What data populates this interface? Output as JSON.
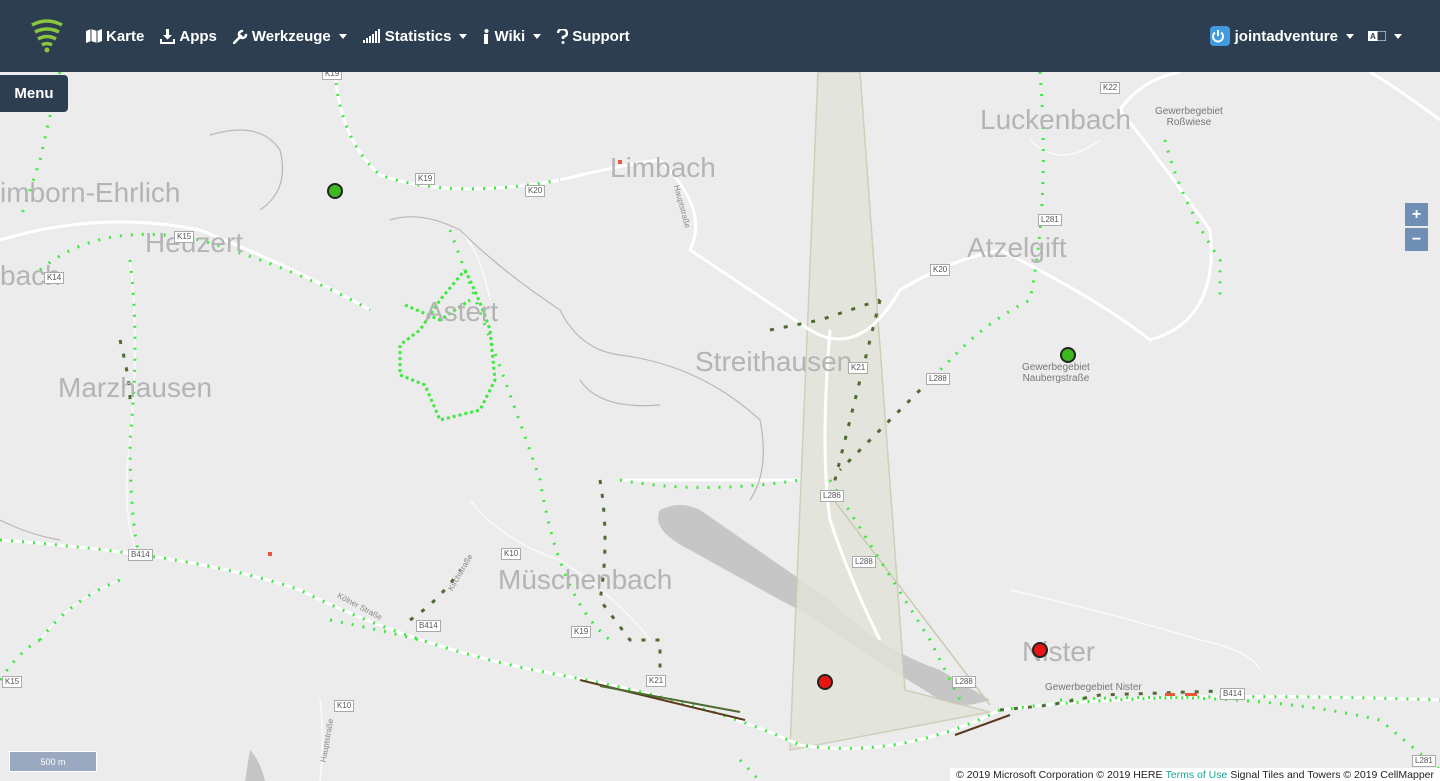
{
  "nav": {
    "items": [
      {
        "label": "Karte",
        "icon": "map-icon"
      },
      {
        "label": "Apps",
        "icon": "download-icon"
      },
      {
        "label": "Werkzeuge",
        "icon": "wrench-icon"
      },
      {
        "label": "Statistics",
        "icon": "signal-bars-icon"
      },
      {
        "label": "Wiki",
        "icon": "info-icon"
      },
      {
        "label": "Support",
        "icon": "question-icon"
      }
    ],
    "user": "jointadventure"
  },
  "menu_label": "Menu",
  "zoom": {
    "in": "+",
    "out": "−"
  },
  "scale_label": "500 m",
  "attribution": {
    "prefix": "© 2019 Microsoft Corporation © 2019 HERE",
    "link": "Terms of Use",
    "suffix": "Signal Tiles and Towers © 2019 CellMapper"
  },
  "places": [
    "Luckenbach",
    "Limbach",
    "imborn-Ehrlich",
    "Heuzert",
    "Atzelgift",
    "bach",
    "Astert",
    "Streithausen",
    "Marzhausen",
    "Müschenbach",
    "Nister"
  ],
  "pois": {
    "rosswiese": [
      "Gewerbegebiet",
      "Roßwiese"
    ],
    "naubergstrasse": [
      "Gewerbegebiet",
      "Naubergstraße"
    ],
    "nister": [
      "Gewerbegebiet Nister"
    ]
  },
  "shields": [
    "K19",
    "K22",
    "K19",
    "K20",
    "K15",
    "L281",
    "K14",
    "K20",
    "K21",
    "L288",
    "L286",
    "L288",
    "B414",
    "K10",
    "B414",
    "K19",
    "K21",
    "L288",
    "B414",
    "K15",
    "K10",
    "L281"
  ],
  "streets": [
    "Hauptstraße",
    "Kölner Straße",
    "Hauptstraße",
    "Kirchstraße"
  ],
  "colors": {
    "navbar": "#2c3e50",
    "signal_strong": "#3ee83e",
    "signal_weak": "#4e6b32",
    "marker_green": "#3db81e",
    "marker_red": "#e81515"
  }
}
